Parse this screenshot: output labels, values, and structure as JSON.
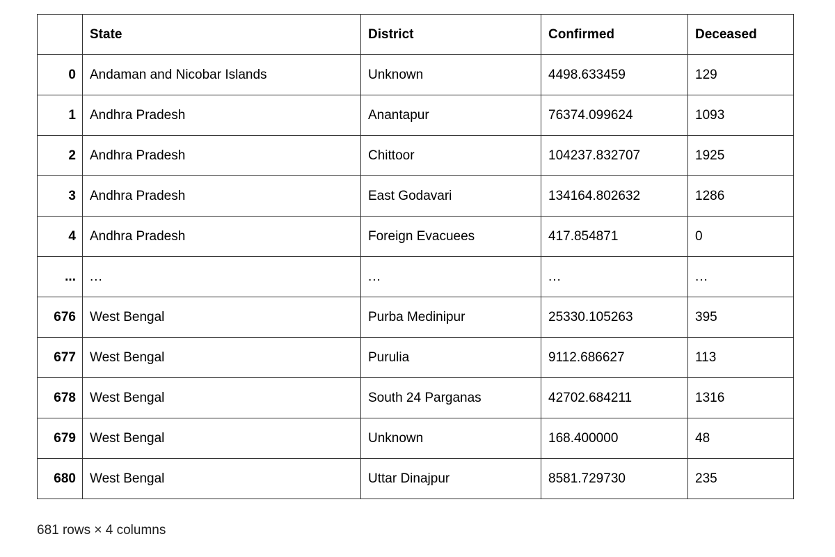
{
  "table": {
    "index_header": "",
    "columns": [
      "State",
      "District",
      "Confirmed",
      "Deceased"
    ],
    "rows": [
      {
        "index": "0",
        "state": "Andaman and Nicobar Islands",
        "district": "Unknown",
        "confirmed": "4498.633459",
        "deceased": "129"
      },
      {
        "index": "1",
        "state": "Andhra Pradesh",
        "district": "Anantapur",
        "confirmed": "76374.099624",
        "deceased": "1093"
      },
      {
        "index": "2",
        "state": "Andhra Pradesh",
        "district": "Chittoor",
        "confirmed": "104237.832707",
        "deceased": "1925"
      },
      {
        "index": "3",
        "state": "Andhra Pradesh",
        "district": "East Godavari",
        "confirmed": "134164.802632",
        "deceased": "1286"
      },
      {
        "index": "4",
        "state": "Andhra Pradesh",
        "district": "Foreign Evacuees",
        "confirmed": "417.854871",
        "deceased": "0"
      },
      {
        "index": "...",
        "state": "...",
        "district": "...",
        "confirmed": "...",
        "deceased": "...",
        "is_ellipsis": true
      },
      {
        "index": "676",
        "state": "West Bengal",
        "district": "Purba Medinipur",
        "confirmed": "25330.105263",
        "deceased": "395"
      },
      {
        "index": "677",
        "state": "West Bengal",
        "district": "Purulia",
        "confirmed": "9112.686627",
        "deceased": "113"
      },
      {
        "index": "678",
        "state": "West Bengal",
        "district": "South 24 Parganas",
        "confirmed": "42702.684211",
        "deceased": "1316"
      },
      {
        "index": "679",
        "state": "West Bengal",
        "district": "Unknown",
        "confirmed": "168.400000",
        "deceased": "48"
      },
      {
        "index": "680",
        "state": "West Bengal",
        "district": "Uttar Dinajpur",
        "confirmed": "8581.729730",
        "deceased": "235"
      }
    ]
  },
  "footer": {
    "shape_text": "681 rows × 4 columns"
  },
  "colors": {
    "border": "#333333",
    "text": "#000000",
    "background": "#ffffff"
  }
}
